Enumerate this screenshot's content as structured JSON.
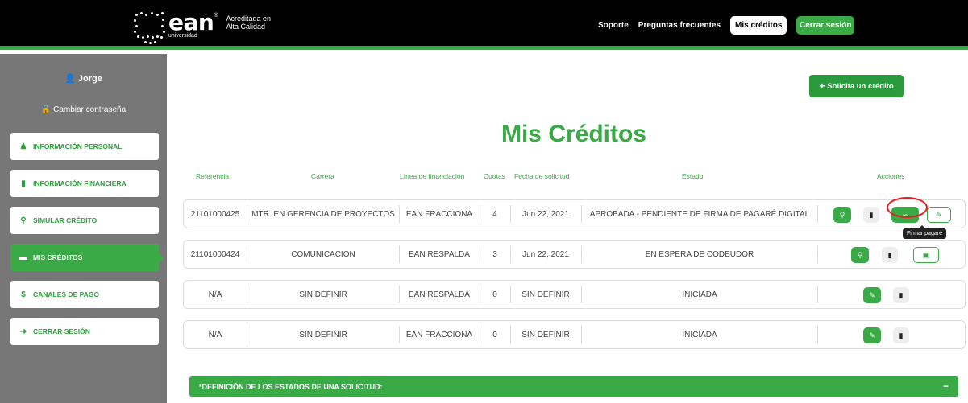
{
  "header": {
    "logo_text": "ean",
    "logo_reg": "®",
    "logo_sub": "universidad",
    "accreditation_line1": "Acreditada en",
    "accreditation_line2": "Alta Calidad",
    "nav_support": "Soporte",
    "nav_faq": "Preguntas frecuentes",
    "nav_my_credits": "Mis créditos",
    "nav_logout": "Cerrar sesión"
  },
  "sidebar": {
    "user_name": "Jorge",
    "change_password": "Cambiar contraseña",
    "items": [
      {
        "label": "INFORMACIÓN PERSONAL",
        "icon": "user-icon"
      },
      {
        "label": "INFORMACIÓN FINANCIERA",
        "icon": "file-icon"
      },
      {
        "label": "SIMULAR CRÉDITO",
        "icon": "search-icon"
      },
      {
        "label": "MIS CRÉDITOS",
        "icon": "card-icon"
      },
      {
        "label": "CANALES DE PAGO",
        "icon": "dollar-icon"
      },
      {
        "label": "CERRAR SESIÓN",
        "icon": "sign-out-icon"
      }
    ]
  },
  "main": {
    "new_credit_button": "Solicita un crédito",
    "title": "Mis Créditos",
    "columns": [
      "Referencia",
      "Carrera",
      "Línea de financiación",
      "Cuotas",
      "Fecha de solicitud",
      "Estado",
      "Acciones"
    ],
    "rows": [
      {
        "ref": "21101000425",
        "career": "MTR. EN GERENCIA DE PROYECTOS",
        "line": "EAN FRACCIONA",
        "installments": "4",
        "date": "Jun 22, 2021",
        "status": "APROBADA - PENDIENTE DE FIRMA DE PAGARÉ DIGITAL"
      },
      {
        "ref": "21101000424",
        "career": "COMUNICACION",
        "line": "EAN RESPALDA",
        "installments": "3",
        "date": "Jun 22, 2021",
        "status": "EN ESPERA DE CODEUDOR"
      },
      {
        "ref": "N/A",
        "career": "SIN DEFINIR",
        "line": "EAN RESPALDA",
        "installments": "0",
        "date": "SIN DEFINIR",
        "status": "INICIADA"
      },
      {
        "ref": "N/A",
        "career": "SIN DEFINIR",
        "line": "EAN FRACCIONA",
        "installments": "0",
        "date": "SIN DEFINIR",
        "status": "INICIADA"
      }
    ],
    "tooltip": "Firmar pagaré",
    "definitions_bar": "*DEFINICIÓN DE LOS ESTADOS DE UNA SOLICITUD:",
    "collapse_symbol": "−"
  },
  "colors": {
    "brand_green": "#3aaa47",
    "sidebar_gray": "#777777",
    "header_black": "#000000",
    "highlight_red": "#e02020"
  }
}
